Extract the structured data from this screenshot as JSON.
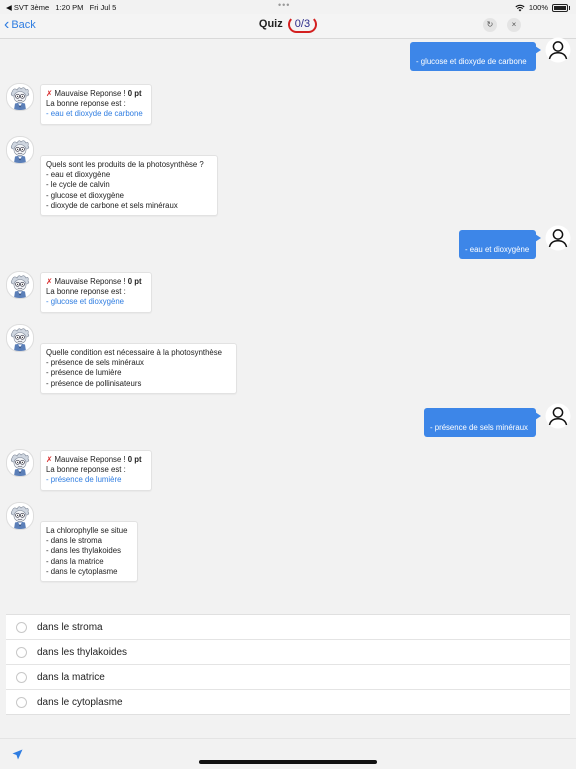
{
  "status": {
    "carrier": "◀ SVT 3ème",
    "time": "1:20 PM",
    "date": "Fri Jul 5",
    "battery": "100%",
    "dots": "•••"
  },
  "nav": {
    "back_label": "Back",
    "title": "Quiz",
    "score": "0/3",
    "refresh_glyph": "↻",
    "close_glyph": "×"
  },
  "messages": {
    "user1": "- glucose et dioxyde de carbone",
    "fb1": {
      "prefix": "Mauvaise Reponse ! ",
      "points": "0 pt",
      "intro": "La bonne reponse est :",
      "answer": "- eau et dioxyde de carbone"
    },
    "q2": [
      "Quels sont les produits de la photosynthèse ?",
      "- eau et dioxygène",
      "- le cycle de calvin",
      "- glucose et dioxygène",
      "- dioxyde de carbone et sels minéraux"
    ],
    "user2": "- eau et dioxygène",
    "fb2": {
      "prefix": "Mauvaise Reponse ! ",
      "points": "0 pt",
      "intro": "La bonne reponse est :",
      "answer": "- glucose et dioxygène"
    },
    "q3": [
      "Quelle condition est nécessaire à la photosynthèse",
      "- présence de sels minéraux",
      "- présence de lumière",
      "- présence de pollinisateurs"
    ],
    "user3": "- présence de sels minéraux",
    "fb3": {
      "prefix": "Mauvaise Reponse ! ",
      "points": "0 pt",
      "intro": "La bonne reponse est :",
      "answer": "- présence de lumière"
    },
    "q4": [
      "La chlorophylle se situe",
      "- dans le stroma",
      "- dans les thylakoides",
      "- dans la matrice",
      "- dans le cytoplasme"
    ]
  },
  "choices": [
    "dans le stroma",
    "dans les thylakoides",
    "dans la matrice",
    "dans le cytoplasme"
  ],
  "icons": {
    "send": "send-icon",
    "user": "user-avatar-icon",
    "bot": "scientist-avatar-icon",
    "wrong": "cross-icon"
  },
  "colors": {
    "accent": "#2f7de1",
    "user_bubble": "#3d86e8",
    "wrong": "#d62a2a",
    "score_ring": "#d31f1f"
  }
}
